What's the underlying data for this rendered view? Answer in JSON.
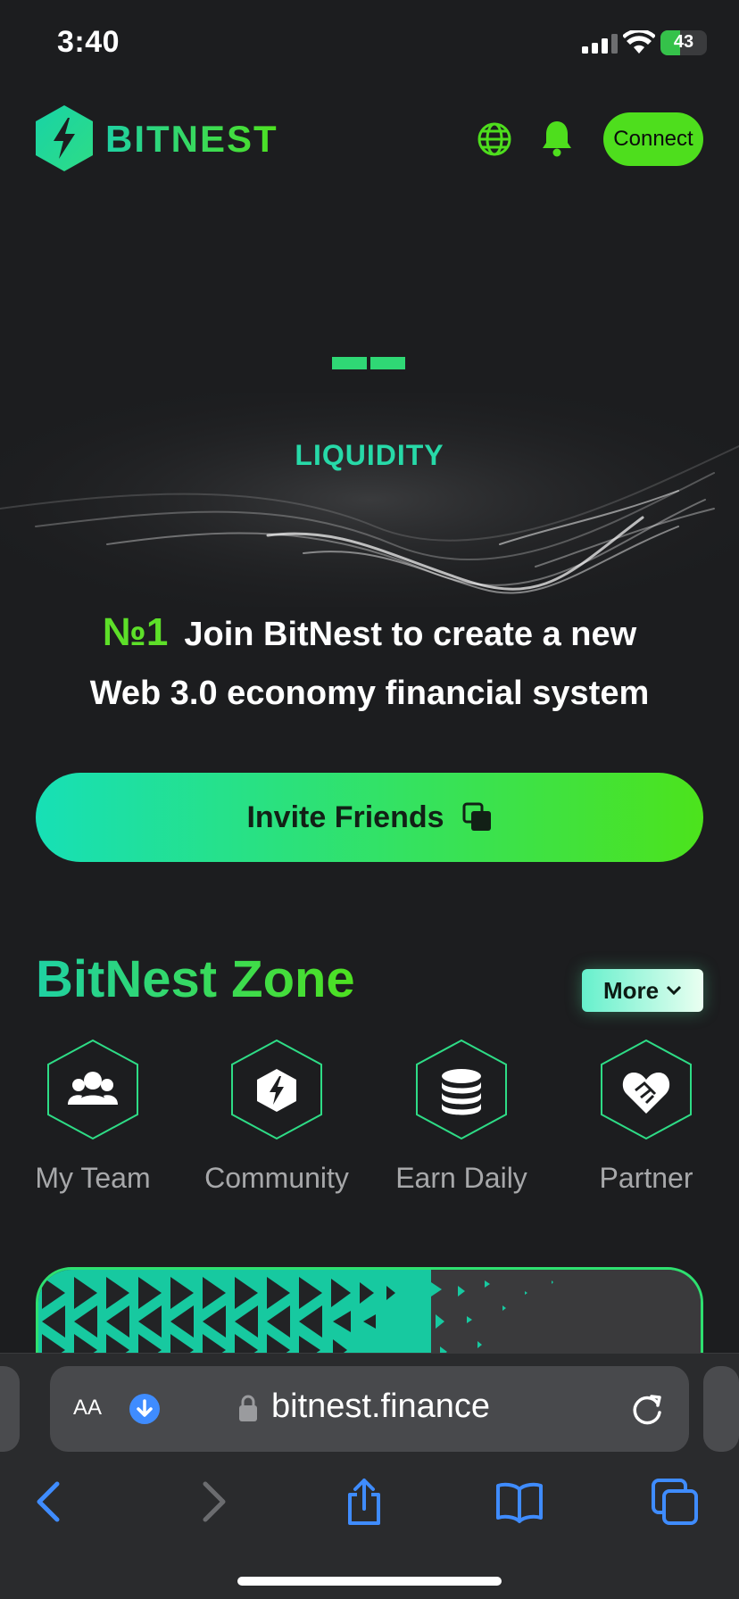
{
  "status_bar": {
    "time": "3:40",
    "battery": "43"
  },
  "header": {
    "brand": "BITNEST",
    "connect_label": "Connect"
  },
  "hero": {
    "label": "LIQUIDITY",
    "slide_count": 2
  },
  "tagline": {
    "rank": "№1",
    "line1": "Join BitNest to create a new",
    "line2": "Web 3.0 economy financial system"
  },
  "invite": {
    "label": "Invite Friends"
  },
  "zone": {
    "title": "BitNest Zone",
    "more_label": "More",
    "items": [
      {
        "label": "My Team",
        "icon": "team-icon"
      },
      {
        "label": "Community",
        "icon": "bitnest-logo-icon"
      },
      {
        "label": "Earn Daily",
        "icon": "coins-icon"
      },
      {
        "label": "Partner",
        "icon": "handshake-heart-icon"
      }
    ]
  },
  "browser": {
    "text_size": "AA",
    "url": "bitnest.finance"
  },
  "colors": {
    "accent_green": "#4ede1d",
    "accent_teal": "#1fd1a3",
    "background": "#1c1d1f",
    "safari_blue": "#3f8cff"
  }
}
